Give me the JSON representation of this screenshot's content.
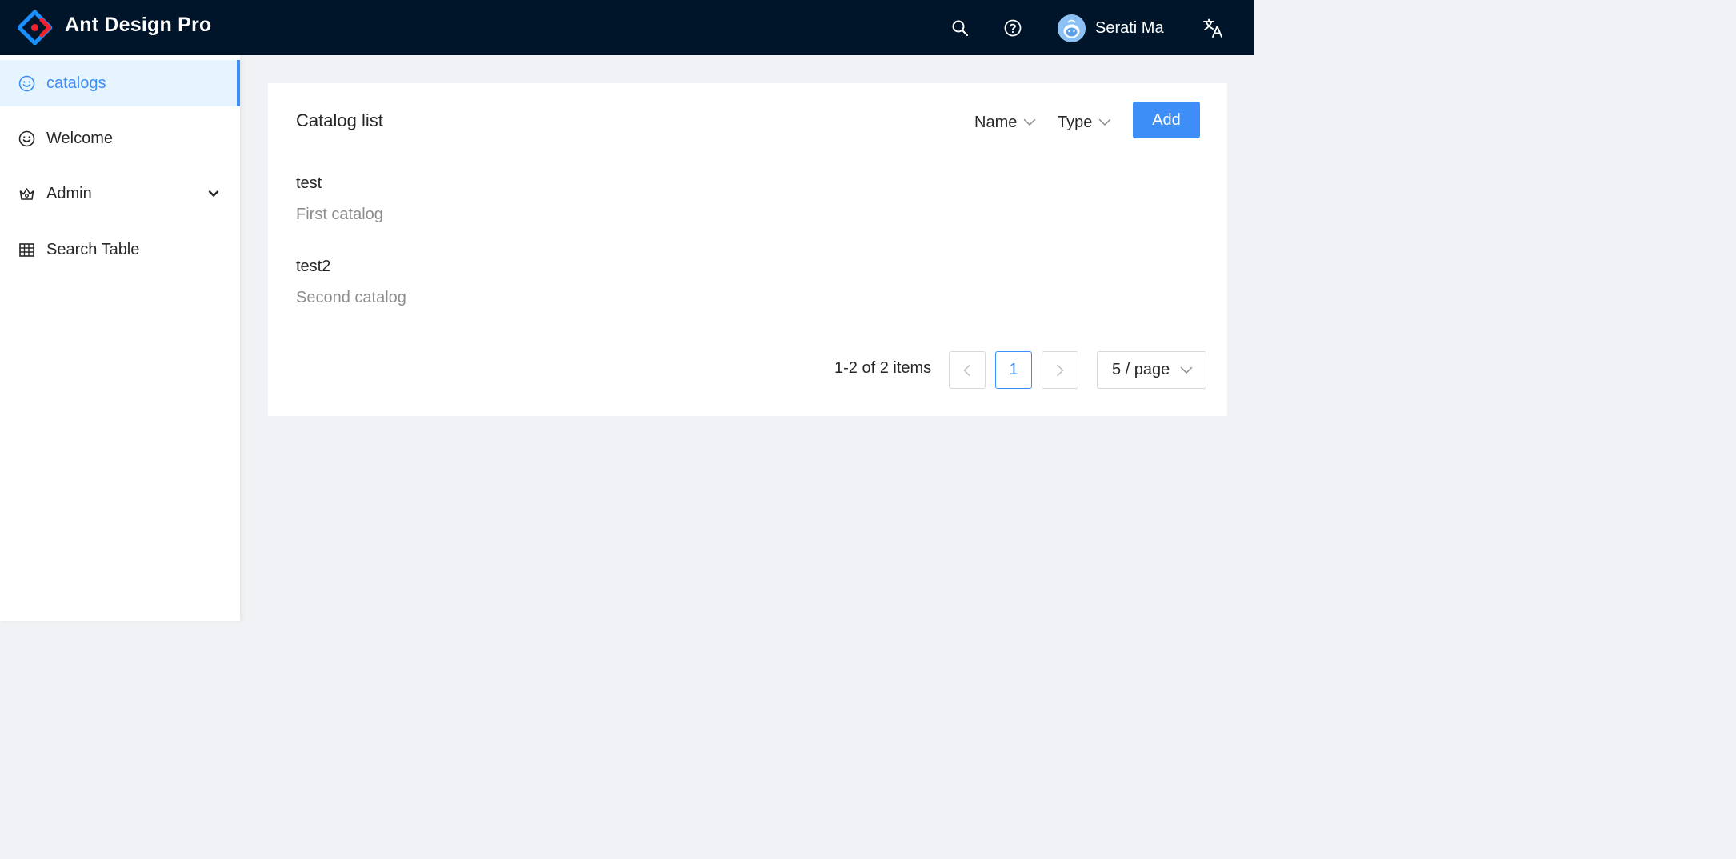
{
  "header": {
    "app_title": "Ant Design Pro",
    "user_name": "Serati Ma",
    "icons": [
      "search-icon",
      "question-circle-icon",
      "translate-icon"
    ]
  },
  "sidebar": {
    "items": [
      {
        "label": "catalogs",
        "icon": "smile-icon",
        "active": true
      },
      {
        "label": "Welcome",
        "icon": "smile-icon",
        "active": false
      },
      {
        "label": "Admin",
        "icon": "crown-icon",
        "active": false,
        "expandable": true
      },
      {
        "label": "Search Table",
        "icon": "table-icon",
        "active": false
      }
    ]
  },
  "main": {
    "card_title": "Catalog list",
    "filters": [
      {
        "label": "Name"
      },
      {
        "label": "Type"
      }
    ],
    "add_label": "Add",
    "list": [
      {
        "title": "test",
        "description": "First catalog"
      },
      {
        "title": "test2",
        "description": "Second catalog"
      }
    ],
    "pagination": {
      "total_text": "1-2 of 2 items",
      "current_page": "1",
      "prev": "<",
      "next": ">",
      "page_size": "5 / page"
    }
  },
  "colors": {
    "header_bg": "#001529",
    "primary": "#3e8ef7",
    "active_bg": "#e6f4ff",
    "page_bg": "#f0f2f5"
  }
}
